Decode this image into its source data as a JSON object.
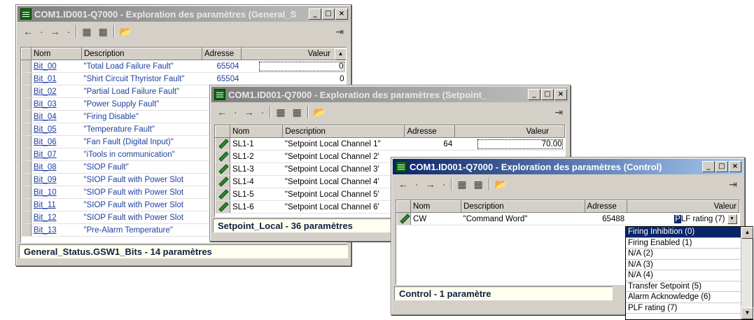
{
  "win1": {
    "title": "COM1.ID001-Q7000 - Exploration des paramètres (General_S",
    "headers": {
      "nom": "Nom",
      "description": "Description",
      "adresse": "Adresse",
      "valeur": "Valeur"
    },
    "rows": [
      {
        "nom": "Bit_00",
        "desc": "\"Total Load Failure Fault\"",
        "addr": "65504",
        "val": "0"
      },
      {
        "nom": "Bit_01",
        "desc": "\"Shirt Circuit Thyristor Fault\"",
        "addr": "65504",
        "val": "0"
      },
      {
        "nom": "Bit_02",
        "desc": "\"Partial Load Failure Fault\"",
        "addr": "",
        "val": ""
      },
      {
        "nom": "Bit_03",
        "desc": "\"Power Supply Fault\"",
        "addr": "",
        "val": ""
      },
      {
        "nom": "Bit_04",
        "desc": "\"Firing Disable\"",
        "addr": "",
        "val": ""
      },
      {
        "nom": "Bit_05",
        "desc": "\"Temperature Fault\"",
        "addr": "",
        "val": ""
      },
      {
        "nom": "Bit_06",
        "desc": "\"Fan Fault (Digital Input)\"",
        "addr": "",
        "val": ""
      },
      {
        "nom": "Bit_07",
        "desc": "\"iTools in communication\"",
        "addr": "",
        "val": ""
      },
      {
        "nom": "Bit_08",
        "desc": "\"SIOP Fault\"",
        "addr": "",
        "val": ""
      },
      {
        "nom": "Bit_09",
        "desc": "\"SIOP Fault with Power Slot",
        "addr": "",
        "val": ""
      },
      {
        "nom": "Bit_10",
        "desc": "\"SIOP Fault with Power Slot",
        "addr": "",
        "val": ""
      },
      {
        "nom": "Bit_11",
        "desc": "\"SIOP Fault with Power Slot",
        "addr": "",
        "val": ""
      },
      {
        "nom": "Bit_12",
        "desc": "\"SIOP Fault with Power Slot",
        "addr": "",
        "val": ""
      },
      {
        "nom": "Bit_13",
        "desc": "\"Pre-Alarm Temperature\"",
        "addr": "",
        "val": ""
      }
    ],
    "status": "General_Status.GSW1_Bits  -  14 paramètres"
  },
  "win2": {
    "title": "COM1.ID001-Q7000 - Exploration des paramètres (Setpoint_",
    "headers": {
      "nom": "Nom",
      "description": "Description",
      "adresse": "Adresse",
      "valeur": "Valeur"
    },
    "rows": [
      {
        "nom": "SL1-1",
        "desc": "\"Setpoint Local Channel 1\"",
        "addr": "64",
        "val": "70.00"
      },
      {
        "nom": "SL1-2",
        "desc": "\"Setpoint Local Channel 2'",
        "addr": "",
        "val": ""
      },
      {
        "nom": "SL1-3",
        "desc": "\"Setpoint Local Channel 3'",
        "addr": "",
        "val": ""
      },
      {
        "nom": "SL1-4",
        "desc": "\"Setpoint Local Channel 4'",
        "addr": "",
        "val": ""
      },
      {
        "nom": "SL1-5",
        "desc": "\"Setpoint Local Channel 5'",
        "addr": "",
        "val": ""
      },
      {
        "nom": "SL1-6",
        "desc": "\"Setpoint Local Channel 6'",
        "addr": "",
        "val": ""
      }
    ],
    "status": "Setpoint_Local  -  36 paramètres"
  },
  "win3": {
    "title": "COM1.ID001-Q7000 - Exploration des paramètres (Control)",
    "headers": {
      "nom": "Nom",
      "description": "Description",
      "adresse": "Adresse",
      "valeur": "Valeur"
    },
    "rows": [
      {
        "nom": "CW",
        "desc": "\"Command Word\"",
        "addr": "65488",
        "val_hl": "P",
        "val": "LF rating (7)"
      }
    ],
    "status": "Control  -  1 paramètre"
  },
  "dropdown": [
    "Firing Inhibition (0)",
    "Firing Enabled (1)",
    "N/A (2)",
    "N/A (3)",
    "N/A (4)",
    "Transfer Setpoint (5)",
    "Alarm Acknowledge (6)",
    "PLF rating (7)"
  ],
  "icons": {
    "back": "←",
    "back_dd": "·",
    "forward": "→",
    "forward_dd": "·",
    "folder1": "▦",
    "folder2": "▦",
    "open": "📂",
    "pin": "⇥",
    "minimize": "_",
    "maximize": "□",
    "close": "×",
    "scroll_up": "▲",
    "scroll_down": "▼",
    "dd_btn": "▼"
  }
}
